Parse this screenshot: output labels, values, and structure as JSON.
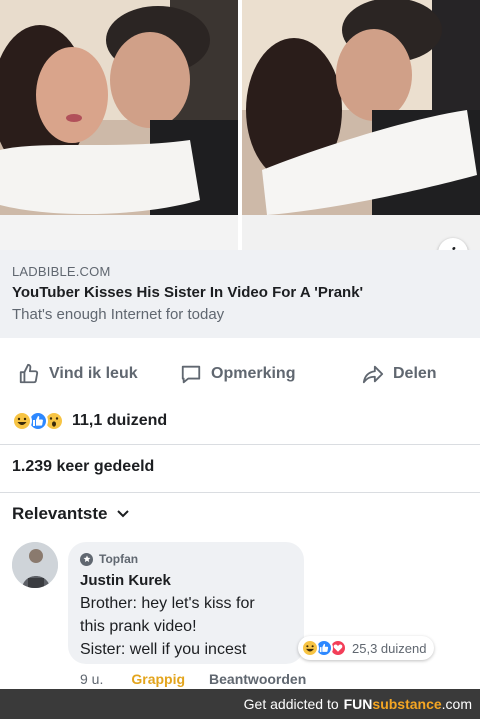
{
  "link": {
    "domain": "LADBIBLE.COM",
    "title": "YouTuber Kisses His Sister In Video For A 'Prank'",
    "description": "That's enough Internet for today",
    "info_icon": "i"
  },
  "actions": {
    "like_label": "Vind ik leuk",
    "comment_label": "Opmerking",
    "share_label": "Delen"
  },
  "reactions": {
    "icons": [
      "haha-icon",
      "like-icon",
      "wow-icon"
    ],
    "count": "11,1 duizend"
  },
  "shares": "1.239 keer gedeeld",
  "sort_label": "Relevantste",
  "comment": {
    "badge": "Topfan",
    "author": "Justin Kurek",
    "lines": [
      "Brother: hey let's kiss for",
      "this prank video!",
      "Sister: well if you incest"
    ],
    "reaction_count": "25,3 duizend",
    "time": "9 u.",
    "my_reaction": "Grappig",
    "reply_label": "Beantwoorden"
  },
  "footer": {
    "text": "Get addicted to",
    "brand_fun": "FUN",
    "brand_substance": "substance",
    "brand_tld": ".com"
  },
  "colors": {
    "accent_like": "#2d88ff",
    "haha": "#f7c444",
    "love": "#f33e58",
    "reacted_text": "#e3a41c"
  }
}
